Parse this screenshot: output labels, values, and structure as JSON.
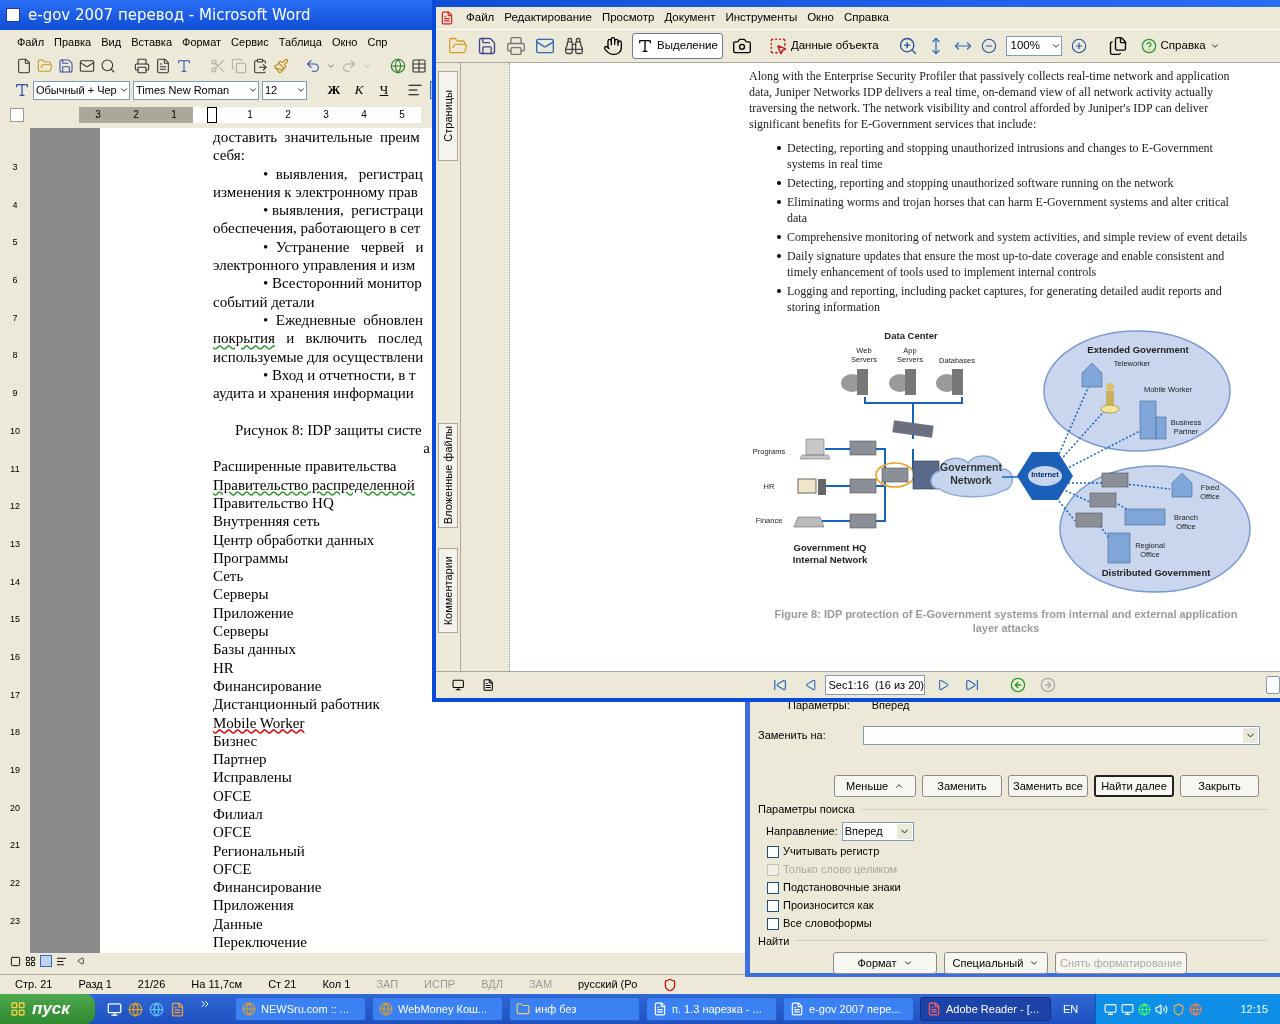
{
  "word": {
    "title": "e-gov 2007 перевод - Microsoft Word",
    "menu": [
      "Файл",
      "Правка",
      "Вид",
      "Вставка",
      "Формат",
      "Сервис",
      "Таблица",
      "Окно",
      "Спр"
    ],
    "style": "Обычный + Чер",
    "font": "Times New Roman",
    "size": "12",
    "format_buttons": [
      "Ж",
      "К",
      "Ч"
    ],
    "ruler_numbers": [
      "3",
      "2",
      "1",
      "1",
      "2",
      "3",
      "4",
      "5"
    ],
    "vertical_ruler_numbers": [
      "3",
      "4",
      "5",
      "6",
      "7",
      "8",
      "9",
      "10",
      "11",
      "12",
      "13",
      "14",
      "15",
      "16",
      "17",
      "18",
      "19",
      "20",
      "21",
      "22",
      "23"
    ],
    "lines": [
      {
        "kind": "plain",
        "text": "доставить  значительные  преим"
      },
      {
        "kind": "plain",
        "text": "себя:"
      },
      {
        "kind": "bullet",
        "text": "•  выявления,   регистрац"
      },
      {
        "kind": "plain",
        "text": "изменения к электронному прав"
      },
      {
        "kind": "bullet",
        "text": "• выявления,  регистраци"
      },
      {
        "kind": "plain",
        "text": "обеспечения, работающего в сет"
      },
      {
        "kind": "bullet",
        "text": "•  Устранение   червей   и"
      },
      {
        "kind": "plain",
        "text": "электронного управления и изм"
      },
      {
        "kind": "bullet",
        "text": "• Всесторонний монитор"
      },
      {
        "kind": "plain",
        "text": "событий детали"
      },
      {
        "kind": "bullet",
        "text": "•  Ежедневные  обновлен"
      },
      {
        "kind": "plain",
        "parts": [
          {
            "text": "покрытия",
            "grammar_error": true
          },
          {
            "text": "   и   включить   послед",
            "grammar_error": false
          }
        ]
      },
      {
        "kind": "plain",
        "text": "используемые для осуществлени"
      },
      {
        "kind": "bullet",
        "text": "• Вход и отчетности, в т"
      },
      {
        "kind": "plain",
        "text": "аудита и хранения информации"
      },
      {
        "kind": "blank"
      },
      {
        "kind": "caption",
        "text": "Рисунок 8: IDP защиты систе"
      },
      {
        "kind": "right",
        "text": "а"
      },
      {
        "kind": "plain",
        "text": "Расширенные правительства"
      },
      {
        "kind": "plain",
        "parts": [
          {
            "text": "Правительство распределенной",
            "grammar_error": true
          }
        ]
      },
      {
        "kind": "plain",
        "text": "Правительство HQ"
      },
      {
        "kind": "plain",
        "text": "Внутренняя сеть"
      },
      {
        "kind": "plain",
        "text": "Центр обработки данных"
      },
      {
        "kind": "plain",
        "text": "Программы"
      },
      {
        "kind": "plain",
        "text": "Сеть"
      },
      {
        "kind": "plain",
        "text": "Серверы"
      },
      {
        "kind": "plain",
        "text": "Приложение"
      },
      {
        "kind": "plain",
        "text": "Серверы"
      },
      {
        "kind": "plain",
        "text": "Базы данных"
      },
      {
        "kind": "plain",
        "text": "HR"
      },
      {
        "kind": "plain",
        "text": "Финансирование"
      },
      {
        "kind": "plain",
        "text": "Дистанционный работник"
      },
      {
        "kind": "plain",
        "parts": [
          {
            "text": "Mobile Worker",
            "spelling_error": true
          }
        ]
      },
      {
        "kind": "plain",
        "text": "Бизнес"
      },
      {
        "kind": "plain",
        "text": "Партнер"
      },
      {
        "kind": "plain",
        "text": "Исправлены"
      },
      {
        "kind": "plain",
        "text": "OFCE"
      },
      {
        "kind": "plain",
        "text": "Филиал"
      },
      {
        "kind": "plain",
        "text": "OFCE"
      },
      {
        "kind": "plain",
        "text": "Региональный"
      },
      {
        "kind": "plain",
        "text": "OFCE"
      },
      {
        "kind": "plain",
        "text": "Финансирование"
      },
      {
        "kind": "plain",
        "text": "Приложения"
      },
      {
        "kind": "plain",
        "text": "Данные"
      },
      {
        "kind": "plain",
        "text": "Переключение"
      }
    ],
    "status_bar": [
      {
        "text": "Стр. 21",
        "disabled": false
      },
      {
        "text": "Разд 1",
        "disabled": false
      },
      {
        "text": "21/26",
        "disabled": false
      },
      {
        "text": "На 11,7см",
        "disabled": false
      },
      {
        "text": "Ст 21",
        "disabled": false
      },
      {
        "text": "Кол 1",
        "disabled": false
      },
      {
        "text": "ЗАП",
        "disabled": true
      },
      {
        "text": "ИСПР",
        "disabled": true
      },
      {
        "text": "ВДЛ",
        "disabled": true
      },
      {
        "text": "ЗАМ",
        "disabled": true
      },
      {
        "text": "русский (Ро",
        "disabled": false
      }
    ]
  },
  "reader": {
    "menu": [
      "Файл",
      "Редактирование",
      "Просмотр",
      "Документ",
      "Инструменты",
      "Окно",
      "Справка"
    ],
    "toolbar": {
      "select_tool": {
        "label": "Выделение",
        "selected": true
      },
      "object_data": "Данные объекта",
      "zoom": "100%",
      "help": "Справка"
    },
    "side_tabs": [
      "Страницы",
      "Вложенные файлы",
      "Комментарии"
    ],
    "paragraph": "Along with the Enterprise Security Profiler that passively collects real-time network and application data, Juniper Networks IDP delivers a real time, on-demand view of all network activity actually traversing the network. The network visibility and control afforded by Juniper's IDP can deliver significant benefits for E-Government services that include:",
    "bullets": [
      "Detecting, reporting and stopping unauthorized intrusions and changes to E-Government systems in real time",
      "Detecting, reporting and stopping unauthorized software running on the network",
      "Eliminating worms and trojan horses that can harm E-Government systems and alter critical data",
      "Comprehensive monitoring of network and system activities, and simple review of event details",
      "Daily signature updates that ensure the most up-to-date coverage and enable consistent and timely enhancement of tools used to implement internal controls",
      "Logging and reporting, including packet captures, for generating detailed audit reports and storing information"
    ],
    "diagram": {
      "labels": [
        {
          "kind": "title",
          "lines": [
            "Data Center"
          ]
        },
        {
          "kind": "small",
          "lines": [
            "Web",
            "Servers"
          ]
        },
        {
          "kind": "small",
          "lines": [
            "App",
            "Servers"
          ]
        },
        {
          "kind": "small",
          "lines": [
            "Databases"
          ]
        },
        {
          "kind": "small",
          "lines": [
            "Programs"
          ]
        },
        {
          "kind": "small",
          "lines": [
            "HR"
          ]
        },
        {
          "kind": "small",
          "lines": [
            "Finance"
          ]
        },
        {
          "kind": "title",
          "lines": [
            "Government HQ",
            "Internal Network"
          ]
        },
        {
          "kind": "big",
          "lines": [
            "Government",
            "Network"
          ]
        },
        {
          "kind": "tiny",
          "lines": [
            "Internet"
          ]
        },
        {
          "kind": "title",
          "lines": [
            "Extended Government"
          ]
        },
        {
          "kind": "small",
          "lines": [
            "Teleworker"
          ]
        },
        {
          "kind": "small",
          "lines": [
            "Mobile Worker"
          ]
        },
        {
          "kind": "small",
          "lines": [
            "Business",
            "Partner"
          ]
        },
        {
          "kind": "small",
          "lines": [
            "Fixed",
            "Office"
          ]
        },
        {
          "kind": "small",
          "lines": [
            "Branch",
            "Office"
          ]
        },
        {
          "kind": "small",
          "lines": [
            "Regional",
            "Office"
          ]
        },
        {
          "kind": "title",
          "lines": [
            "Distributed Government"
          ]
        }
      ]
    },
    "caption": "Figure 8: IDP protection of E-Government systems from internal and external application layer attacks",
    "page_field": "Sec1:16  (16 из 20)"
  },
  "find_dialog": {
    "params_label": "Параметры:",
    "params_value": "Вперед",
    "replace_label": "Заменить на:",
    "buttons": [
      {
        "label": "Меньше",
        "kind": "collapse",
        "default": false
      },
      {
        "label": "Заменить",
        "kind": "plain",
        "default": false
      },
      {
        "label": "Заменить все",
        "kind": "plain",
        "default": false
      },
      {
        "label": "Найти далее",
        "kind": "plain",
        "default": true
      },
      {
        "label": "Закрыть",
        "kind": "plain",
        "default": false
      }
    ],
    "options_title": "Параметры поиска",
    "direction_label": "Направление:",
    "direction_value": "Вперед",
    "checkboxes": [
      {
        "label": "Учитывать регистр",
        "checked": false,
        "disabled": false
      },
      {
        "label": "Только слово целиком",
        "checked": false,
        "disabled": true
      },
      {
        "label": "Подстановочные знаки",
        "checked": false,
        "disabled": false
      },
      {
        "label": "Произносится как",
        "checked": false,
        "disabled": false
      },
      {
        "label": "Все словоформы",
        "checked": false,
        "disabled": false
      }
    ],
    "find_title": "Найти",
    "bottom_buttons": [
      {
        "label": "Формат",
        "menu": true,
        "disabled": false
      },
      {
        "label": "Специальный",
        "menu": true,
        "disabled": false
      },
      {
        "label": "Снять форматирование",
        "menu": false,
        "disabled": true
      }
    ]
  },
  "taskbar": {
    "start": "пуск",
    "tasks": [
      {
        "label": "NEWSru.com :: ...",
        "kind": "browser",
        "selected": false
      },
      {
        "label": "WebMoney Кош...",
        "kind": "browser",
        "selected": false
      },
      {
        "label": "инф без",
        "kind": "folder",
        "selected": false
      },
      {
        "label": "п. 1.3 нарезка - ...",
        "kind": "word",
        "selected": false
      },
      {
        "label": "e-gov 2007 пере...",
        "kind": "word",
        "selected": false
      },
      {
        "label": "Adobe Reader - [...",
        "kind": "pdf",
        "selected": true
      }
    ],
    "language": "EN",
    "clock": "12:15"
  }
}
